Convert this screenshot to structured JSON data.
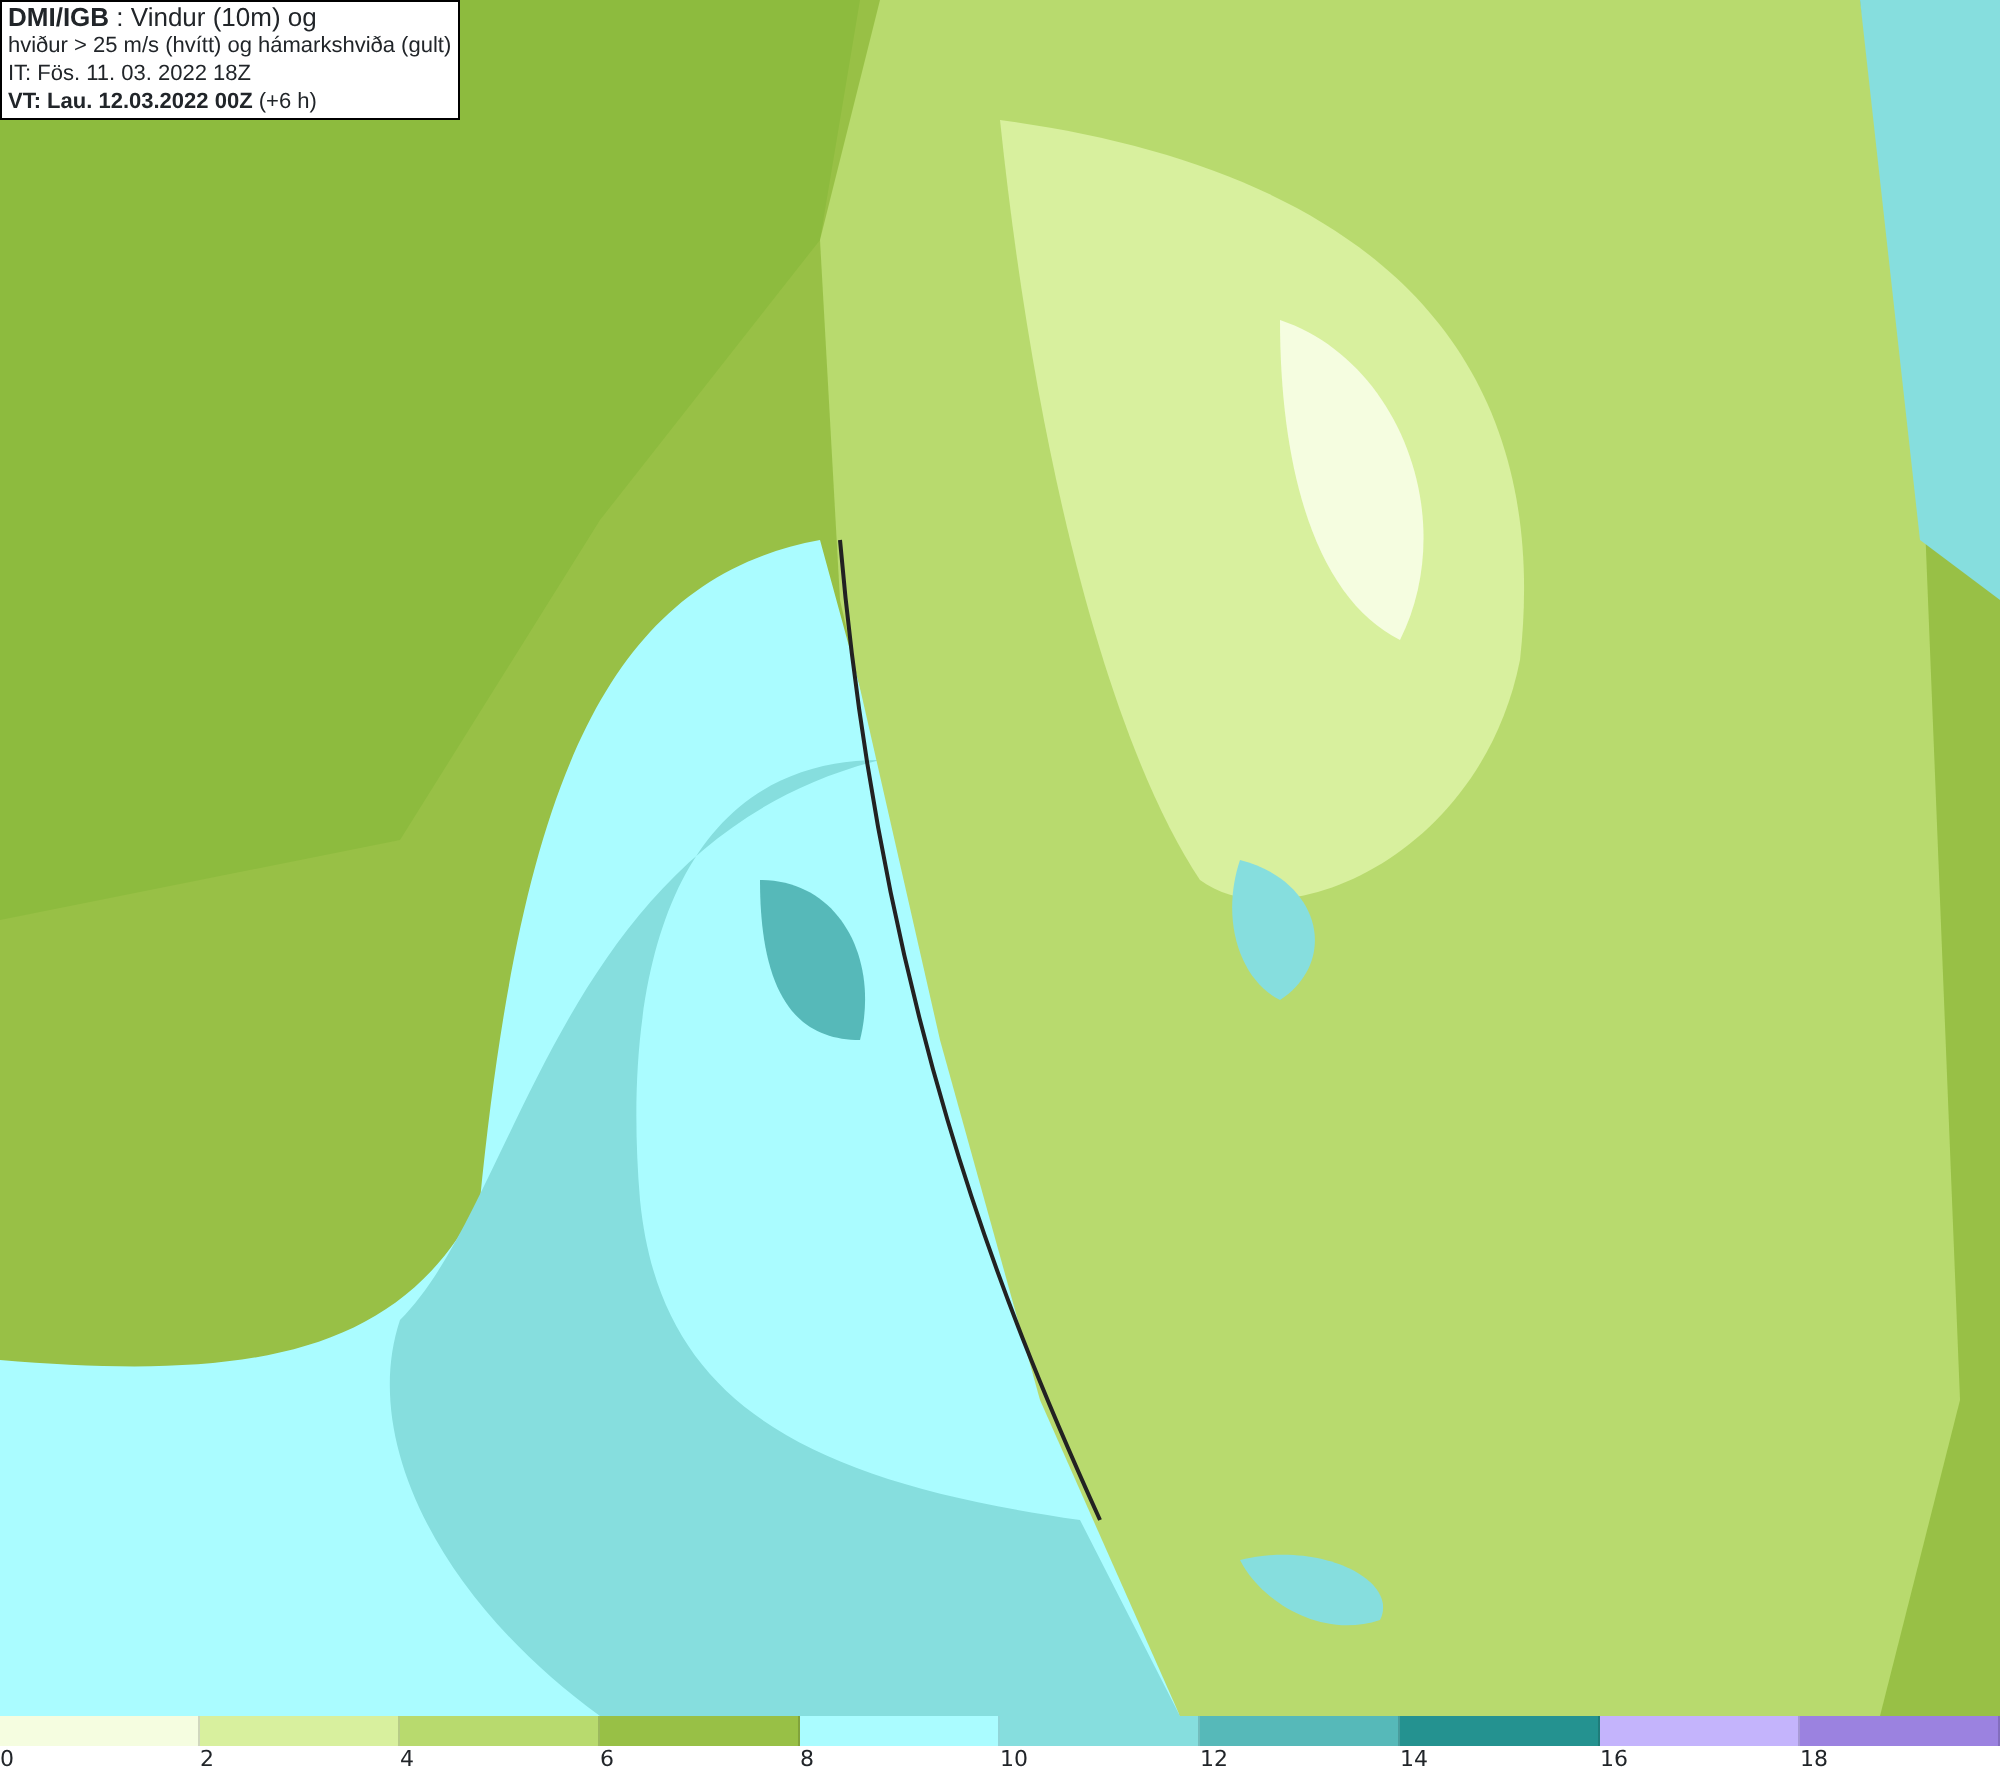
{
  "title_box": {
    "lines": [
      "**DMI/IGB** : Vindur (10m) og",
      "hviður > 25 m/s (hvítt) og hámarkshviða (gult)",
      "IT: Fös. 11. 03. 2022 18Z",
      "**VT: Lau. 12.03.2022 00Z** (+6 h)"
    ]
  },
  "legend": {
    "bins": [
      {
        "color": "#f5fde0",
        "label": "0"
      },
      {
        "color": "#d8f09e",
        "label": "2"
      },
      {
        "color": "#b8da6e",
        "label": "4"
      },
      {
        "color": "#98c046",
        "label": "6"
      },
      {
        "color": "#aafcff",
        "label": "8"
      },
      {
        "color": "#86dede",
        "label": "10"
      },
      {
        "color": "#56b9b9",
        "label": "12"
      },
      {
        "color": "#249290",
        "label": "14"
      },
      {
        "color": "#c4b4fc",
        "label": "16"
      },
      {
        "color": "#9b82e0",
        "label": "18"
      }
    ]
  }
}
